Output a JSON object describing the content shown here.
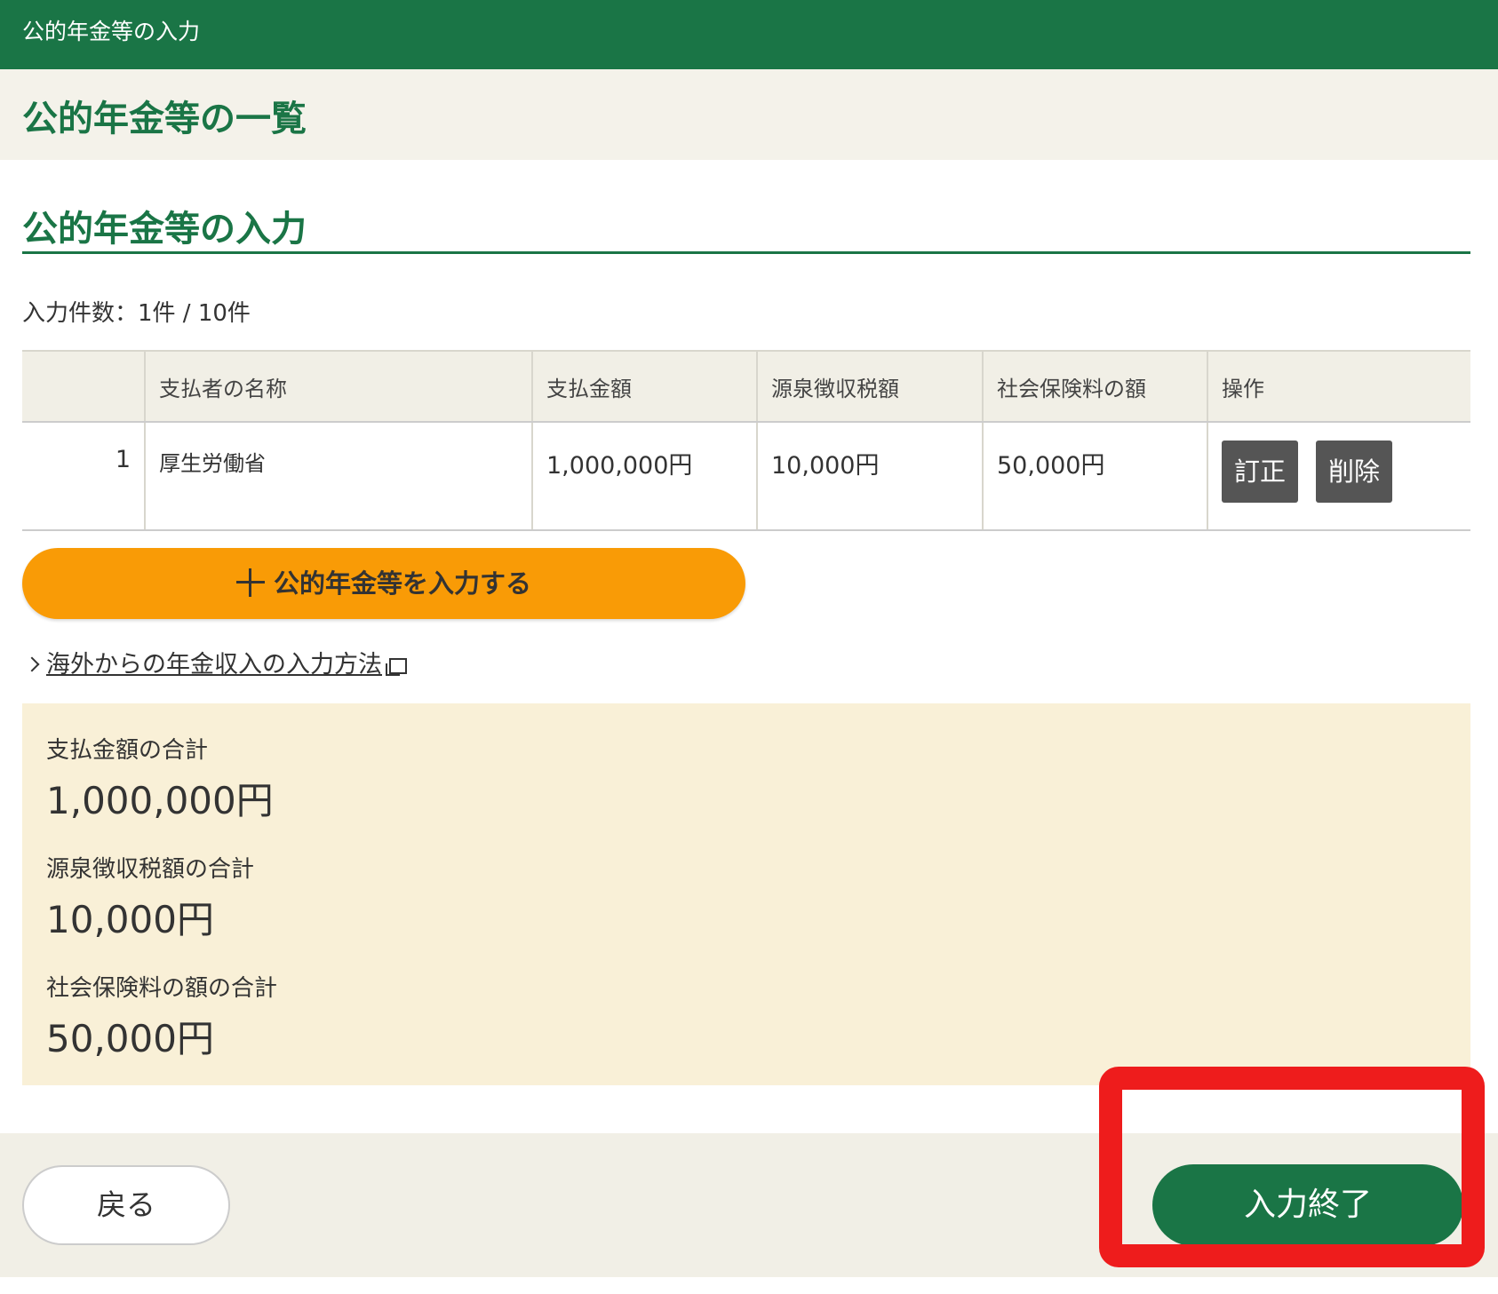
{
  "header": {
    "title": "公的年金等の入力"
  },
  "list_section": {
    "title": "公的年金等の一覧"
  },
  "input_section": {
    "title": "公的年金等の入力",
    "count_text": "入力件数：1件 / 10件"
  },
  "table": {
    "columns": [
      "",
      "支払者の名称",
      "支払金額",
      "源泉徴収税額",
      "社会保険料の額",
      "操作"
    ],
    "rows": [
      {
        "no": "1",
        "payer_name": "厚生労働省",
        "payment_amount": "1,000,000円",
        "withholding_tax": "10,000円",
        "social_insurance": "50,000円",
        "edit_label": "訂正",
        "delete_label": "削除"
      }
    ]
  },
  "add_button": {
    "label": "公的年金等を入力する",
    "icon": "plus-icon",
    "color": "#f99b06"
  },
  "overseas_link": {
    "label": "海外からの年金収入の入力方法"
  },
  "totals": {
    "payment_label": "支払金額の合計",
    "payment_value": "1,000,000円",
    "withholding_label": "源泉徴収税額の合計",
    "withholding_value": "10,000円",
    "insurance_label": "社会保険料の額の合計",
    "insurance_value": "50,000円"
  },
  "footer": {
    "back_label": "戻る",
    "finish_label": "入力終了"
  },
  "colors": {
    "brand_green": "#1a7546",
    "highlight_red": "#ee1c1c",
    "totals_bg": "#f9f0d7"
  }
}
